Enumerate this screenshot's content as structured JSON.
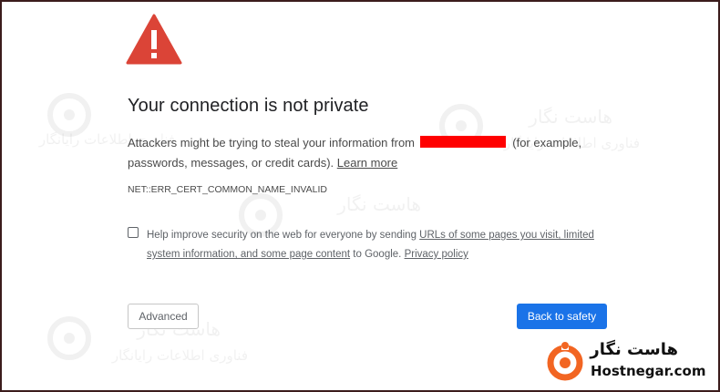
{
  "page": {
    "title": "Your connection is not private",
    "description_before": "Attackers might be trying to steal your information from",
    "description_after": "(for example, passwords, messages, or credit cards).",
    "learn_more": "Learn more",
    "error_code": "NET::ERR_CERT_COMMON_NAME_INVALID"
  },
  "optin": {
    "checked": false,
    "text_before": "Help improve security on the web for everyone by sending",
    "link1": "URLs of some pages you visit, limited system information, and some page content",
    "text_middle": "to Google.",
    "link2": "Privacy policy"
  },
  "buttons": {
    "advanced": "Advanced",
    "back_to_safety": "Back to safety"
  },
  "colors": {
    "warning_red": "#db4437",
    "primary_button": "#1a73e8",
    "redaction": "#ff0000",
    "brand_orange": "#f26522"
  },
  "brand": {
    "name_fa": "هاست نگار",
    "name_en": "Hostnegar.com"
  },
  "watermarks": {
    "name_fa": "هاست نگار",
    "tagline_fa": "فناوری اطلاعات رایانگار"
  }
}
